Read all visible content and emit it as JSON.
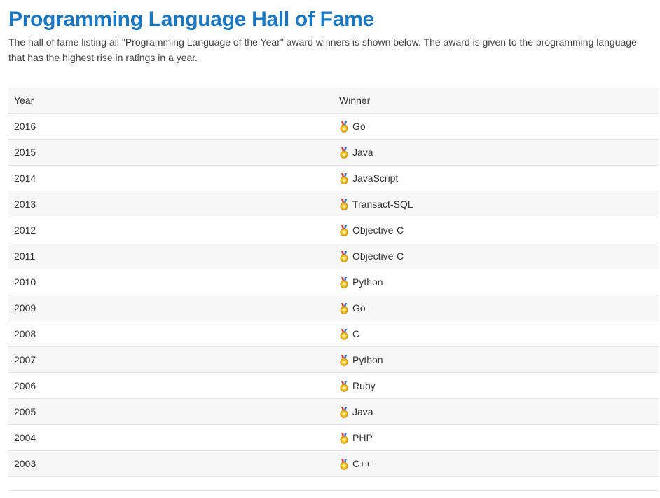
{
  "page": {
    "title": "Programming Language Hall of Fame",
    "intro": "The hall of fame listing all \"Programming Language of the Year\" award winners is shown below. The award is given to the programming language that has the highest rise in ratings in a year."
  },
  "table": {
    "headers": {
      "year": "Year",
      "winner": "Winner"
    },
    "rows": [
      {
        "year": "2016",
        "winner": "Go",
        "icon": "medal-icon"
      },
      {
        "year": "2015",
        "winner": "Java",
        "icon": "medal-icon"
      },
      {
        "year": "2014",
        "winner": "JavaScript",
        "icon": "medal-icon"
      },
      {
        "year": "2013",
        "winner": "Transact-SQL",
        "icon": "medal-icon"
      },
      {
        "year": "2012",
        "winner": "Objective-C",
        "icon": "medal-icon"
      },
      {
        "year": "2011",
        "winner": "Objective-C",
        "icon": "medal-icon"
      },
      {
        "year": "2010",
        "winner": "Python",
        "icon": "medal-icon"
      },
      {
        "year": "2009",
        "winner": "Go",
        "icon": "medal-icon"
      },
      {
        "year": "2008",
        "winner": "C",
        "icon": "medal-icon"
      },
      {
        "year": "2007",
        "winner": "Python",
        "icon": "medal-icon"
      },
      {
        "year": "2006",
        "winner": "Ruby",
        "icon": "medal-icon"
      },
      {
        "year": "2005",
        "winner": "Java",
        "icon": "medal-icon"
      },
      {
        "year": "2004",
        "winner": "PHP",
        "icon": "medal-icon"
      },
      {
        "year": "2003",
        "winner": "C++",
        "icon": "medal-icon"
      }
    ]
  },
  "colors": {
    "title": "#1a77c2",
    "row_shade": "#f7f7f7",
    "divider": "#e3e3e3",
    "medal_gold": "#f4c21a",
    "ribbon_red": "#d9302a"
  }
}
